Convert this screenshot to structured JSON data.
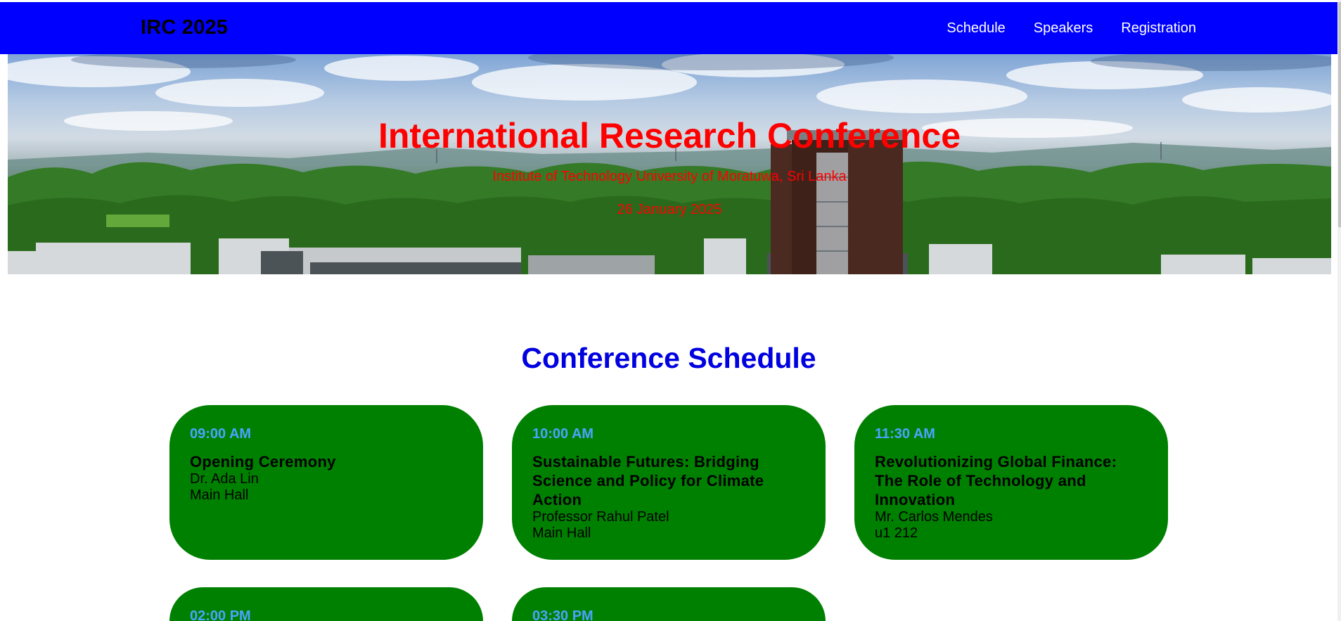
{
  "navbar": {
    "brand": "IRC 2025",
    "links": [
      "Schedule",
      "Speakers",
      "Registration"
    ]
  },
  "hero": {
    "title": "International Research Conference",
    "subtitle": "Institute of Technology University of Moratuwa, Sri Lanka",
    "date": "26 January 2025"
  },
  "schedule": {
    "heading": "Conference Schedule",
    "sessions": [
      {
        "time": "09:00 AM",
        "title": "Opening Ceremony",
        "speaker": "Dr. Ada Lin",
        "room": "Main Hall"
      },
      {
        "time": "10:00 AM",
        "title": "Sustainable Futures: Bridging Science and Policy for Climate Action",
        "speaker": "Professor Rahul Patel",
        "room": "Main Hall"
      },
      {
        "time": "11:30 AM",
        "title": "Revolutionizing Global Finance: The Role of Technology and Innovation",
        "speaker": "Mr. Carlos Mendes",
        "room": "u1 212"
      },
      {
        "time": "02:00 PM"
      },
      {
        "time": "03:30 PM"
      }
    ]
  },
  "colors": {
    "navbar": "#0000ff",
    "card": "#008000",
    "time": "#4aa3ff",
    "heading": "#0000e0",
    "hero_text": "#ff0000"
  }
}
